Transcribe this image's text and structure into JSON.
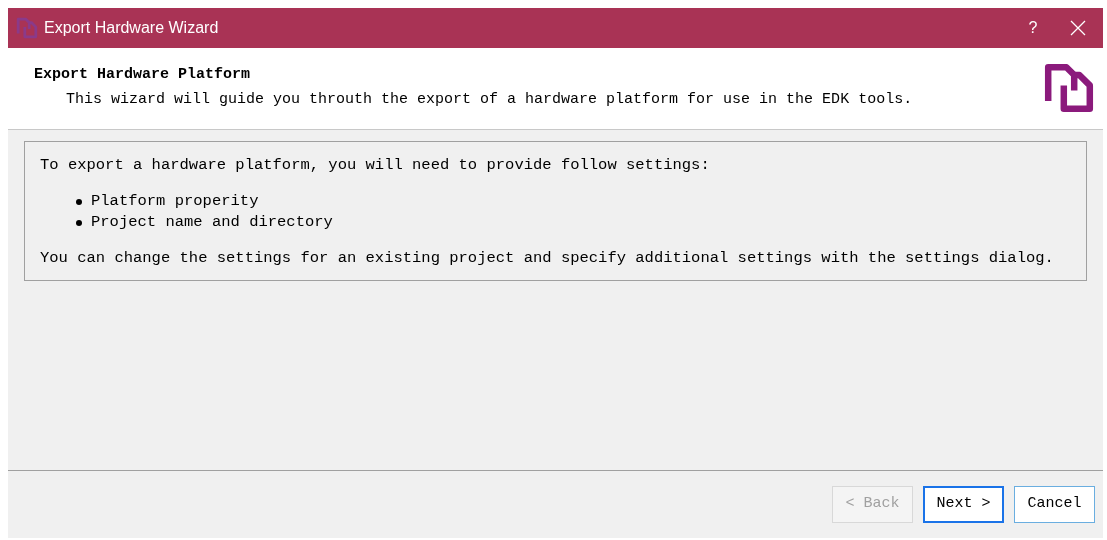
{
  "window": {
    "title": "Export Hardware Wizard",
    "help": "?"
  },
  "header": {
    "title": "Export Hardware Platform",
    "subtitle": "This wizard will guide you throuth the export of a hardware platform for use in the EDK tools."
  },
  "info": {
    "intro": "To export a hardware platform, you will need to provide follow settings:",
    "bullets": [
      "Platform properity",
      "Project name and directory"
    ],
    "note": "You can change the settings for an existing project and specify additional settings with the settings dialog."
  },
  "buttons": [
    {
      "label": "< Back",
      "disabled": true,
      "default": false
    },
    {
      "label": "Next >",
      "disabled": false,
      "default": true
    },
    {
      "label": "Cancel",
      "disabled": false,
      "default": false
    }
  ]
}
